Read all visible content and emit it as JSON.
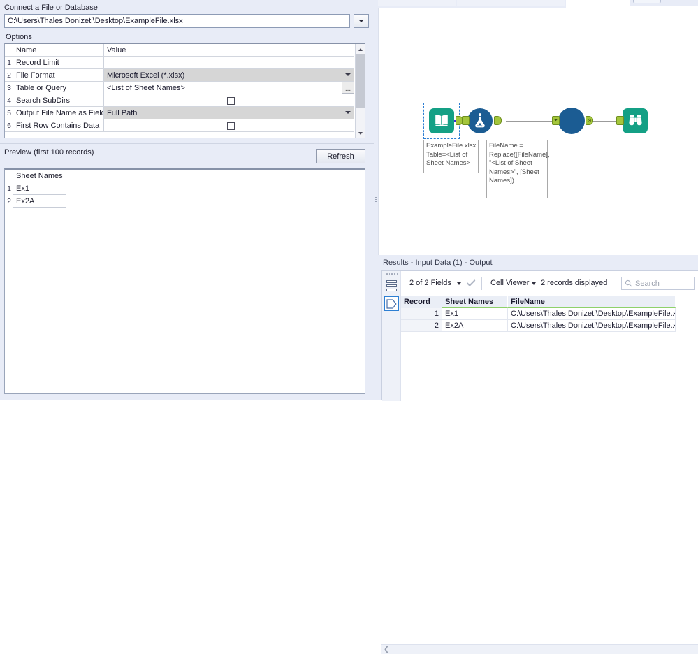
{
  "config_panel": {
    "connect_label": "Connect a File or Database",
    "file_path": "C:\\Users\\Thales Donizeti\\Desktop\\ExampleFile.xlsx",
    "dropdown_icon": "chevron-down-icon",
    "options_label": "Options",
    "grid": {
      "headers": [
        "Name",
        "Value"
      ],
      "rows": [
        {
          "num": "1",
          "name": "Record Limit",
          "value": "",
          "type": "text"
        },
        {
          "num": "2",
          "name": "File Format",
          "value": "Microsoft Excel (*.xlsx)",
          "type": "combo"
        },
        {
          "num": "3",
          "name": "Table or Query",
          "value": "<List of Sheet Names>",
          "type": "ellipsis",
          "ellipsis_label": "..."
        },
        {
          "num": "4",
          "name": "Search SubDirs",
          "value": "",
          "type": "checkbox",
          "checked": false
        },
        {
          "num": "5",
          "name": "Output File Name as Field",
          "value": "Full Path",
          "type": "combo"
        },
        {
          "num": "6",
          "name": "First Row Contains Data",
          "value": "",
          "type": "checkbox",
          "checked": false
        }
      ]
    },
    "preview_label": "Preview (first 100 records)",
    "refresh_label": "Refresh",
    "preview_table": {
      "headers": [
        "Sheet Names"
      ],
      "rows": [
        {
          "num": "1",
          "cells": [
            "Ex1"
          ]
        },
        {
          "num": "2",
          "cells": [
            "Ex2A"
          ]
        }
      ]
    }
  },
  "canvas": {
    "nodes": [
      {
        "id": "input-data",
        "icon": "book-icon",
        "shape": "square",
        "selected": true
      },
      {
        "id": "formula",
        "icon": "flask-icon",
        "shape": "circle",
        "selected": false
      },
      {
        "id": "tool-circle",
        "icon": "circle-tool-icon",
        "shape": "plain-circle",
        "selected": false
      },
      {
        "id": "browse",
        "icon": "binoculars-icon",
        "shape": "square",
        "selected": false
      }
    ],
    "annotations": [
      {
        "id": "input-annotation",
        "text": "ExampleFile.xlsx Table=<List of Sheet Names>"
      },
      {
        "id": "formula-annotation",
        "text": "FileName = Replace([FileName], \"<List of Sheet Names>\", [Sheet Names])"
      }
    ]
  },
  "results_panel": {
    "title": "Results - Input Data (1) - Output",
    "toolbar": {
      "fields_label": "2 of 2 Fields",
      "fields_caret": "chevron-down-icon",
      "check_icon": "check-icon",
      "cell_viewer_label": "Cell Viewer",
      "cell_viewer_caret": "chevron-down-icon",
      "records_label": "2 records displayed",
      "search_placeholder": "Search",
      "search_value": "",
      "search_icon": "search-icon"
    },
    "sidebar_icons": [
      "grip-dots-icon",
      "data-rows-icon",
      "tag-pentagon-icon"
    ],
    "table": {
      "headers": [
        "Record",
        "Sheet Names",
        "FileName"
      ],
      "rows": [
        {
          "record": "1",
          "sheet_names": "Ex1",
          "filename": "C:\\Users\\Thales Donizeti\\Desktop\\ExampleFile.xls…"
        },
        {
          "record": "2",
          "sheet_names": "Ex2A",
          "filename": "C:\\Users\\Thales Donizeti\\Desktop\\ExampleFile.xls…"
        }
      ]
    },
    "scroll_left_icon": "chevron-left-icon"
  },
  "colors": {
    "panel_bg": "#e8ecf7",
    "node_teal": "#14a085",
    "node_blue": "#1b5c93",
    "anchor_green": "#a4c63c",
    "selected_wire": "#3c2fcf",
    "header_underline": "#8ed16a"
  }
}
